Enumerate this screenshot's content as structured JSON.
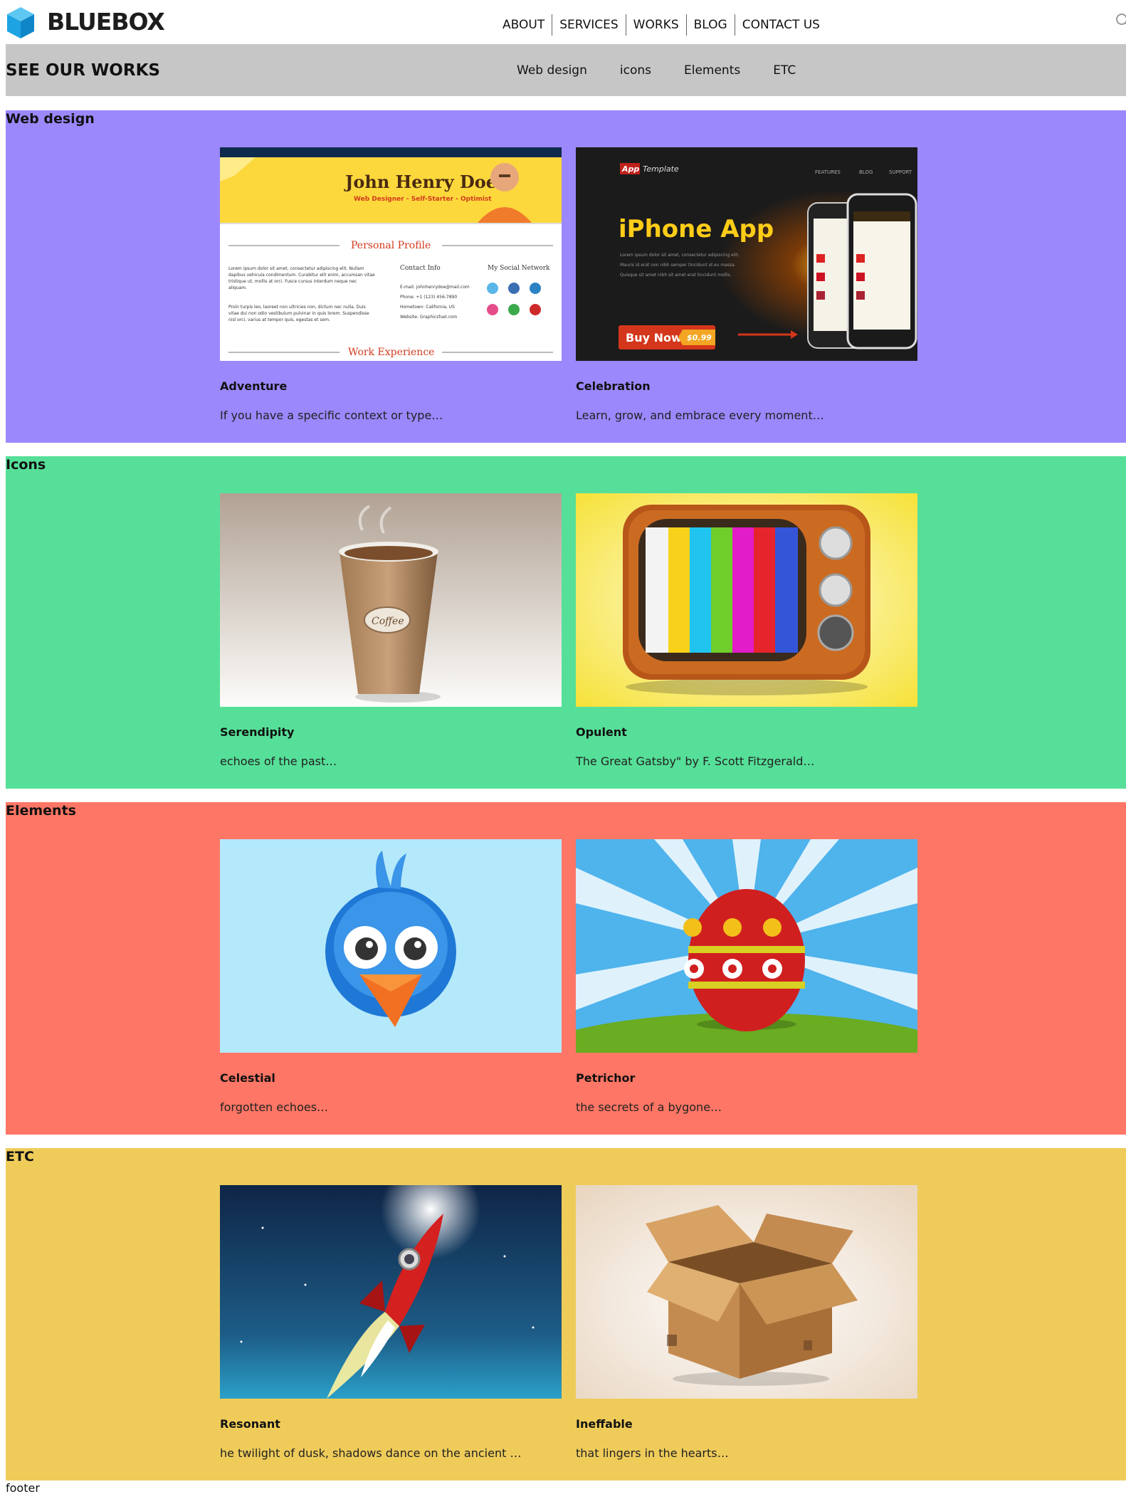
{
  "header": {
    "logo_text": "BLUEBOX",
    "nav": [
      "ABOUT",
      "SERVICES",
      "WORKS",
      "BLOG",
      "CONTACT US"
    ]
  },
  "subheader": {
    "title": "SEE OUR WORKS",
    "filters": [
      "Web design",
      "icons",
      "Elements",
      "ETC"
    ]
  },
  "sections": [
    {
      "title": "Web design",
      "color": "#9c88fd",
      "cards": [
        {
          "title": "Adventure",
          "desc": "If you have a specific context or type…",
          "image": "resume-website",
          "image_text": {
            "name": "John Henry Doe",
            "tagline": "Web Designer - Self-Starter - Optimist",
            "profile_heading": "Personal Profile",
            "contact_heading": "Contact Info",
            "social_heading": "My Social Network",
            "lorem1": "Lorem ipsum dolor sit amet, consectetur adipiscing elit. Nullam dapibus vehicula condimentum. Curabitur elit enim, accumsan vitae tristique ut, mollis at orci. Fusce cursus interdum neque nec aliquam.",
            "lorem2": "Proin turpis leo, laoreet non ultricies non, dictum nec nulla. Duis vitae dui non odio vestibulum pulvinar in quis lorem. Suspendisse nisl orci, varius at tempor quis, egestas et sem.",
            "contact_lines": [
              "E-mail: johnhenrydoe@mail.com",
              "Phone: +1 (123) 456-7890",
              "Hometown: California, US",
              "Website: Graphicsfuel.com"
            ],
            "work_heading": "Work Experience"
          }
        },
        {
          "title": "Celebration",
          "desc": "Learn, grow, and embrace every moment…",
          "image": "iphone-app-template",
          "image_text": {
            "brand_accent": "App",
            "brand": "Template",
            "menu": [
              "FEATURES",
              "BLOG",
              "SUPPORT"
            ],
            "headline": "iPhone App",
            "body1": "Lorem ipsum dolor sit amet, consectetur adipiscing elit.",
            "body2": "Mauris id erat non nibh semper tincidunt id eu massa.",
            "body3": "Quisque sit amet nibh sit amet erat tincidunt mollis.",
            "cta": "Buy Now",
            "price": "$0.99"
          }
        }
      ]
    },
    {
      "title": "Icons",
      "color": "#56df98",
      "cards": [
        {
          "title": "Serendipity",
          "desc": "echoes of the past…",
          "image": "coffee-cup-icon",
          "image_text": {
            "label": "Coffee"
          }
        },
        {
          "title": "Opulent",
          "desc": "The Great Gatsby\" by F. Scott Fitzgerald…",
          "image": "retro-tv-icon"
        }
      ]
    },
    {
      "title": "Elements",
      "color": "#fe7665",
      "cards": [
        {
          "title": "Celestial",
          "desc": "forgotten echoes…",
          "image": "blue-bird-icon"
        },
        {
          "title": "Petrichor",
          "desc": "the secrets of a bygone…",
          "image": "easter-egg-icon"
        }
      ]
    },
    {
      "title": "ETC",
      "color": "#efcc5a",
      "cards": [
        {
          "title": "Resonant",
          "desc": "he twilight of dusk, shadows dance on the ancient …",
          "image": "rocket-icon"
        },
        {
          "title": "Ineffable",
          "desc": "that lingers in the hearts…",
          "image": "cardboard-box-icon"
        }
      ]
    }
  ],
  "footer": {
    "text": "footer"
  }
}
